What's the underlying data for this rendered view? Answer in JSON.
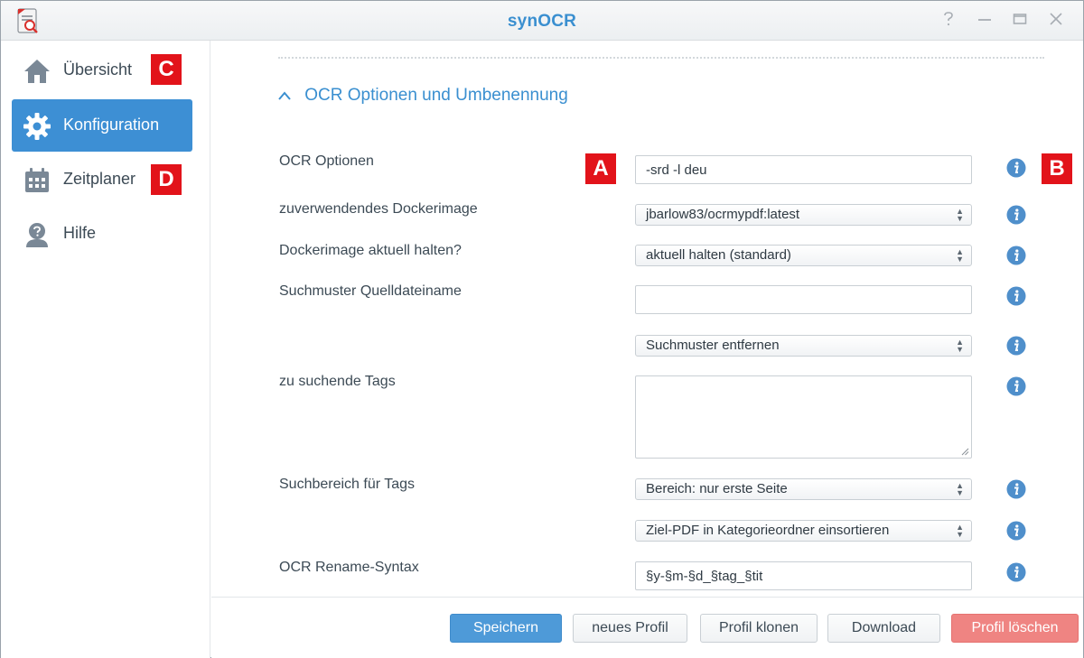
{
  "window": {
    "title": "synOCR"
  },
  "sidebar": {
    "items": [
      {
        "label": "Übersicht",
        "icon": "home-icon"
      },
      {
        "label": "Konfiguration",
        "icon": "gear-icon",
        "active": true
      },
      {
        "label": "Zeitplaner",
        "icon": "calendar-icon"
      },
      {
        "label": "Hilfe",
        "icon": "help-person-icon"
      }
    ]
  },
  "annotations": {
    "a": "A",
    "b": "B",
    "c": "C",
    "d": "D"
  },
  "section": {
    "title": "OCR Optionen und Umbenennung"
  },
  "form": {
    "ocr_options": {
      "label": "OCR Optionen",
      "value": "-srd -l deu"
    },
    "docker_image": {
      "label": "zuverwendendes Dockerimage",
      "value": "jbarlow83/ocrmypdf:latest"
    },
    "docker_update": {
      "label": "Dockerimage aktuell halten?",
      "value": "aktuell halten (standard)"
    },
    "search_pattern": {
      "label": "Suchmuster Quelldateiname",
      "value": ""
    },
    "pattern_action": {
      "value": "Suchmuster entfernen"
    },
    "tags": {
      "label": "zu suchende Tags",
      "value": ""
    },
    "tag_range": {
      "label": "Suchbereich für Tags",
      "value": "Bereich: nur erste Seite"
    },
    "category_sort": {
      "value": "Ziel-PDF in Kategorieordner einsortieren"
    },
    "rename_syntax": {
      "label": "OCR Rename-Syntax",
      "value": "§y-§m-§d_§tag_§tit"
    }
  },
  "footer": {
    "save": "Speichern",
    "new_profile": "neues Profil",
    "clone_profile": "Profil klonen",
    "download": "Download",
    "delete_profile": "Profil löschen"
  },
  "colors": {
    "accent": "#3d8fd4",
    "badge": "#e2131a",
    "danger": "#ef8482"
  }
}
